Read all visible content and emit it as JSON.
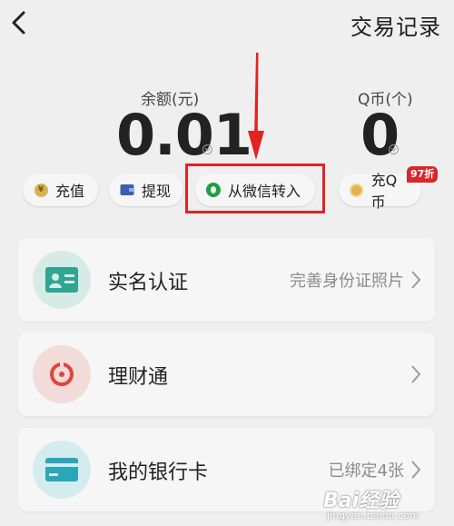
{
  "header": {
    "title": "交易记录",
    "back_icon": "chevron-left-icon"
  },
  "balance": {
    "label": "余额(元)",
    "value": "0.01"
  },
  "qcoin": {
    "label": "Q币(个)",
    "value": "0"
  },
  "actions": [
    {
      "label": "充值",
      "icon": "coin-icon"
    },
    {
      "label": "提现",
      "icon": "wallet-icon"
    },
    {
      "label": "从微信转入",
      "icon": "wechat-icon"
    },
    {
      "label": "充Q币",
      "icon": "qcoin-icon",
      "badge": "97折"
    }
  ],
  "cards": [
    {
      "label": "实名认证",
      "value": "完善身份证照片",
      "icon": "id-card-icon",
      "icon_color": "#2fa592"
    },
    {
      "label": "理财通",
      "value": "",
      "icon": "licaitong-icon",
      "icon_color": "#e0463f"
    },
    {
      "label": "我的银行卡",
      "value": "已绑定4张",
      "icon": "bank-card-icon",
      "icon_color": "#2aa6b8"
    }
  ],
  "annotation": {
    "color": "#e32222"
  },
  "watermark": {
    "logo_text": "Bai经验",
    "url": "jingyan.baidu.com"
  }
}
